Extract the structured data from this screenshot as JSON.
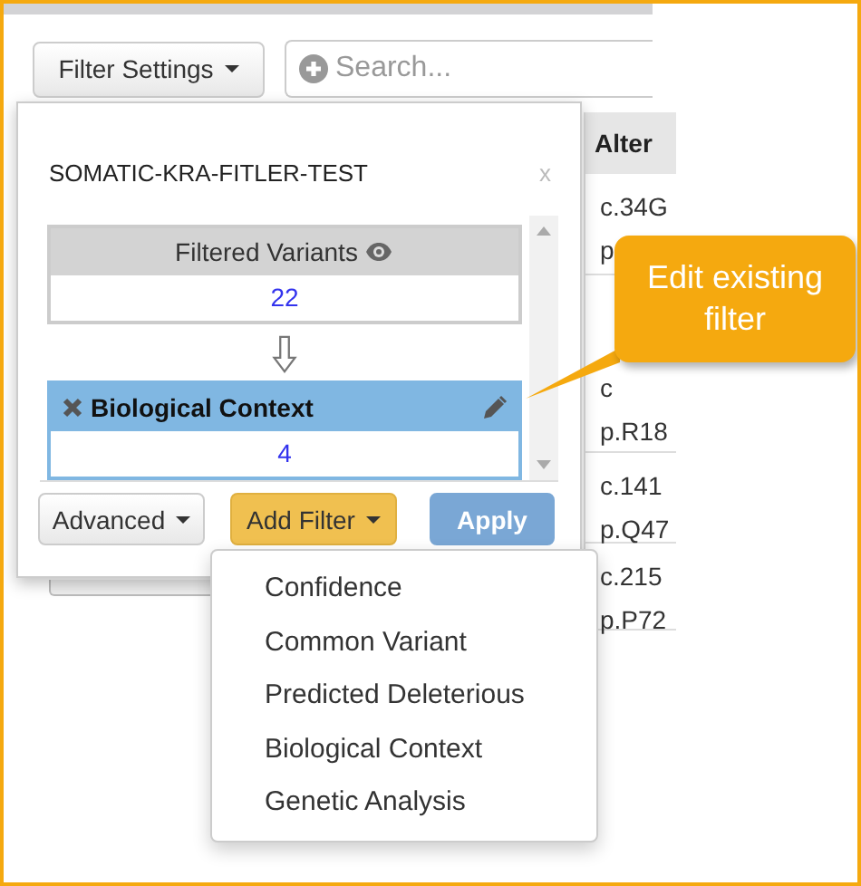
{
  "toolbar": {
    "filter_button": "Filter Settings",
    "search": {
      "placeholder": "Search..."
    }
  },
  "table": {
    "header": "Alter",
    "rows": [
      {
        "line1": "c.34G",
        "line2": "p"
      },
      {
        "line1": "c",
        "line2": "p.R18"
      },
      {
        "line1": "c.141",
        "line2": "p.Q47"
      },
      {
        "line1": "c.215",
        "line2": "p.P72"
      }
    ]
  },
  "popover": {
    "title": "SOMATIC-KRA-FITLER-TEST",
    "close": "x",
    "filters": [
      {
        "kind": "source",
        "label": "Filtered Variants",
        "count": "22"
      },
      {
        "kind": "filter",
        "label": "Biological Context",
        "count": "4"
      }
    ],
    "buttons": [
      {
        "kind": "dropdown",
        "label": "Advanced",
        "expanded": false
      },
      {
        "kind": "dropdown",
        "label": "Add Filter",
        "expanded": true
      },
      {
        "kind": "primary",
        "label": "Apply"
      }
    ]
  },
  "menu": {
    "items": [
      "Confidence",
      "Common Variant",
      "Predicted Deleterious",
      "Biological Context",
      "Genetic Analysis"
    ]
  },
  "callout": {
    "text": "Edit existing filter"
  }
}
